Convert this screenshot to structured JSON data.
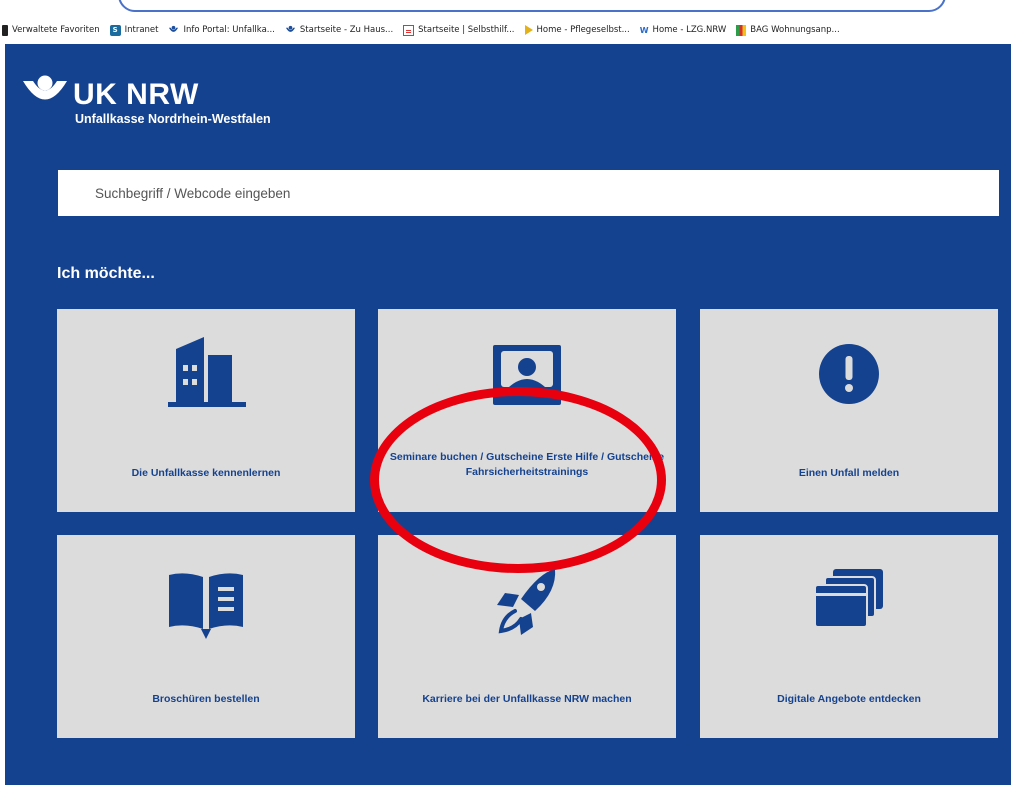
{
  "browser": {
    "bookmarks": [
      {
        "label": "Verwaltete Favoriten",
        "icon": "folder-icon"
      },
      {
        "label": "Intranet",
        "icon": "sharepoint-icon"
      },
      {
        "label": "Info Portal: Unfallka...",
        "icon": "uknrw-logo-icon"
      },
      {
        "label": "Startseite - Zu Haus...",
        "icon": "uknrw-logo-icon"
      },
      {
        "label": "Startseite | Selbsthilf...",
        "icon": "document-icon"
      },
      {
        "label": "Home - Pflegeselbst...",
        "icon": "arrow-icon"
      },
      {
        "label": "Home - LZG.NRW",
        "icon": "w-icon"
      },
      {
        "label": "BAG Wohnungsanp...",
        "icon": "bag-icon"
      }
    ]
  },
  "site": {
    "brand": "UK NRW",
    "subtitle": "Unfallkasse Nordrhein-Westfalen",
    "search_placeholder": "Suchbegriff / Webcode eingeben",
    "intro": "Ich möchte...",
    "tiles": [
      {
        "label": "Die Unfallkasse kennenlernen",
        "icon": "building-icon"
      },
      {
        "label": "Seminare buchen / Gutscheine Erste Hilfe / Gutscheine Fahrsicherheitstrainings",
        "icon": "certificate-icon"
      },
      {
        "label": "Einen Unfall melden",
        "icon": "exclamation-icon"
      },
      {
        "label": "Broschüren bestellen",
        "icon": "book-icon"
      },
      {
        "label": "Karriere bei der Unfallkasse NRW machen",
        "icon": "rocket-icon"
      },
      {
        "label": "Digitale Angebote entdecken",
        "icon": "windows-icon"
      }
    ]
  },
  "colors": {
    "brand_blue": "#15428f",
    "tile_gray": "#dcdcdc",
    "highlight_red": "#e8000f"
  }
}
